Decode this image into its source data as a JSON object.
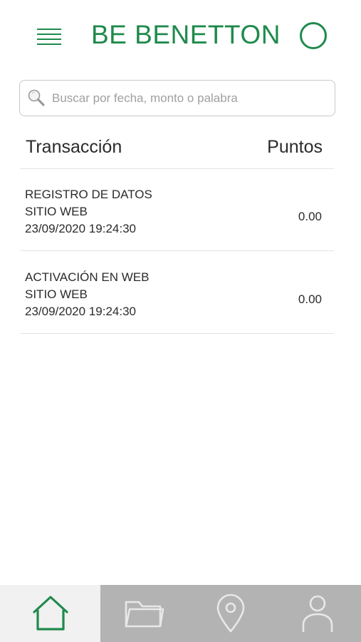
{
  "header": {
    "brand": "BE BENETTON",
    "menu_icon": "menu-icon",
    "profile_icon": "circle-icon",
    "brand_color": "#1f8a4c"
  },
  "search": {
    "placeholder": "Buscar por fecha, monto o palabra",
    "value": "",
    "icon": "search-icon"
  },
  "table": {
    "headers": {
      "transaction": "Transacción",
      "points": "Puntos"
    },
    "rows": [
      {
        "title": "REGISTRO DE DATOS",
        "channel": "SITIO WEB",
        "datetime": "23/09/2020 19:24:30",
        "points": "0.00"
      },
      {
        "title": "ACTIVACIÓN EN WEB",
        "channel": "SITIO WEB",
        "datetime": "23/09/2020 19:24:30",
        "points": "0.00"
      }
    ]
  },
  "bottom_nav": {
    "items": [
      {
        "icon": "home-icon",
        "active": true
      },
      {
        "icon": "folder-icon",
        "active": false
      },
      {
        "icon": "location-pin-icon",
        "active": false
      },
      {
        "icon": "user-icon",
        "active": false
      }
    ],
    "active_color": "#1f8a4c",
    "inactive_color": "#e8e8e8",
    "bar_color": "#b3b3b3"
  }
}
